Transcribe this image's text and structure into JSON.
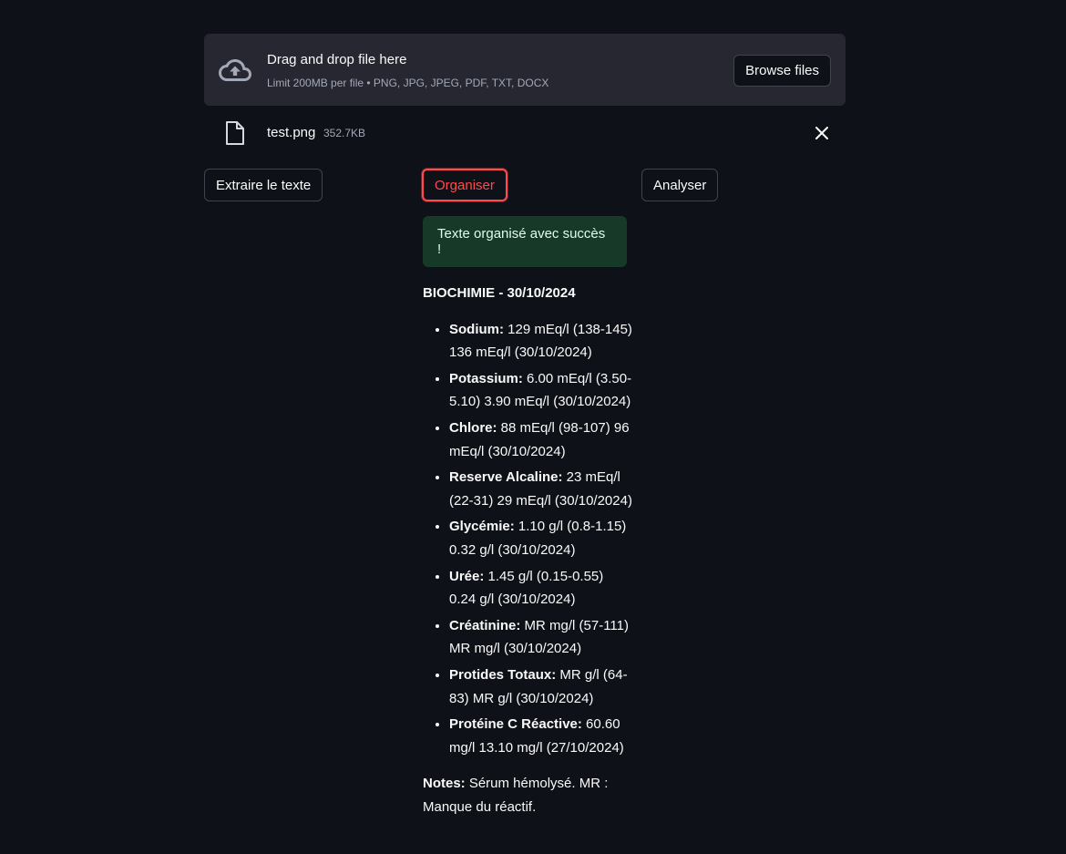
{
  "uploader": {
    "title": "Drag and drop file here",
    "limit": "Limit 200MB per file • PNG, JPG, JPEG, PDF, TXT, DOCX",
    "browse_label": "Browse files",
    "icon": "cloud-upload-icon"
  },
  "file": {
    "name": "test.png",
    "size": "352.7KB",
    "icon": "file-icon"
  },
  "buttons": {
    "extract": "Extraire le texte",
    "organize": "Organiser",
    "analyze": "Analyser"
  },
  "success_message": "Texte organisé avec succès !",
  "result": {
    "title": "BIOCHIMIE - 30/10/2024",
    "items": [
      {
        "name": "Sodium:",
        "text": " 129 mEq/l (138-145) 136 mEq/l (30/10/2024)"
      },
      {
        "name": "Potassium:",
        "text": " 6.00 mEq/l (3.50-5.10) 3.90 mEq/l (30/10/2024)"
      },
      {
        "name": "Chlore:",
        "text": " 88 mEq/l (98-107) 96 mEq/l (30/10/2024)"
      },
      {
        "name": "Reserve Alcaline:",
        "text": " 23 mEq/l (22-31) 29 mEq/l (30/10/2024)"
      },
      {
        "name": "Glycémie:",
        "text": " 1.10 g/l (0.8-1.15) 0.32 g/l (30/10/2024)"
      },
      {
        "name": "Urée:",
        "text": " 1.45 g/l (0.15-0.55) 0.24 g/l (30/10/2024)"
      },
      {
        "name": "Créatinine:",
        "text": " MR mg/l (57-111) MR mg/l (30/10/2024)"
      },
      {
        "name": "Protides Totaux:",
        "text": " MR g/l (64-83) MR g/l (30/10/2024)"
      },
      {
        "name": "Protéine C Réactive:",
        "text": " 60.60 mg/l 13.10 mg/l (27/10/2024)"
      }
    ],
    "notes_label": "Notes:",
    "notes_text": " Sérum hémolysé. MR : Manque du réactif."
  },
  "colors": {
    "background": "#0e1117",
    "surface": "#262730",
    "accent": "#ff4b4b",
    "success_bg": "#173928"
  }
}
